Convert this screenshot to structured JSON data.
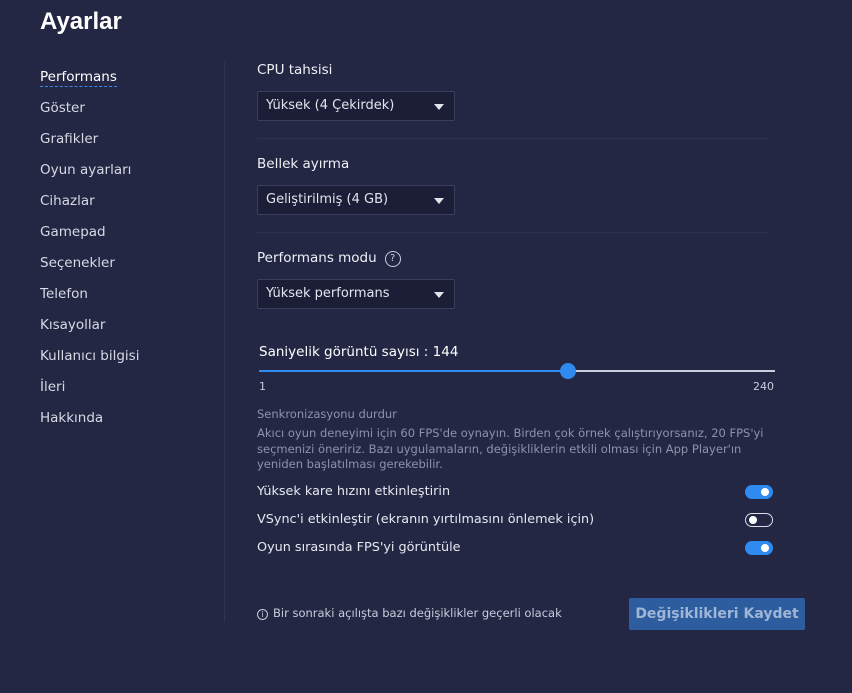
{
  "page": {
    "title": "Ayarlar"
  },
  "sidebar": {
    "items": [
      {
        "label": "Performans",
        "active": true
      },
      {
        "label": "Göster"
      },
      {
        "label": "Grafikler"
      },
      {
        "label": "Oyun ayarları"
      },
      {
        "label": "Cihazlar"
      },
      {
        "label": "Gamepad"
      },
      {
        "label": "Seçenekler"
      },
      {
        "label": "Telefon"
      },
      {
        "label": "Kısayollar"
      },
      {
        "label": "Kullanıcı bilgisi"
      },
      {
        "label": "İleri"
      },
      {
        "label": "Hakkında"
      }
    ]
  },
  "cpu": {
    "label": "CPU tahsisi",
    "value": "Yüksek (4 Çekirdek)"
  },
  "memory": {
    "label": "Bellek ayırma",
    "value": "Geliştirilmiş (4 GB)"
  },
  "perf_mode": {
    "label": "Performans modu",
    "help_glyph": "?",
    "value": "Yüksek performans"
  },
  "fps": {
    "label": "Saniyelik görüntü sayısı : 144",
    "min": 1,
    "max": 240,
    "value": 144,
    "min_label": "1",
    "max_label": "240"
  },
  "sync": {
    "title": "Senkronizasyonu durdur",
    "description": "Akıcı oyun deneyimi için 60 FPS'de oynayın. Birden çok örnek çalıştırıyorsanız, 20 FPS'yi seçmenizi öneririz. Bazı uygulamaların, değişikliklerin etkili olması için App Player'ın yeniden başlatılması gerekebilir."
  },
  "toggles": [
    {
      "label": "Yüksek kare hızını etkinleştirin",
      "on": true
    },
    {
      "label": "VSync'i etkinleştir (ekranın yırtılmasını önlemek için)",
      "on": false
    },
    {
      "label": "Oyun sırasında FPS'yi görüntüle",
      "on": true
    }
  ],
  "footer": {
    "info_glyph": "i",
    "note": "Bir sonraki açılışta bazı değişiklikler geçerli olacak",
    "save_label": "Değişiklikleri Kaydet"
  },
  "colors": {
    "background": "#232744",
    "accent": "#2f8bf0",
    "save_button": "#2d5d9f"
  }
}
